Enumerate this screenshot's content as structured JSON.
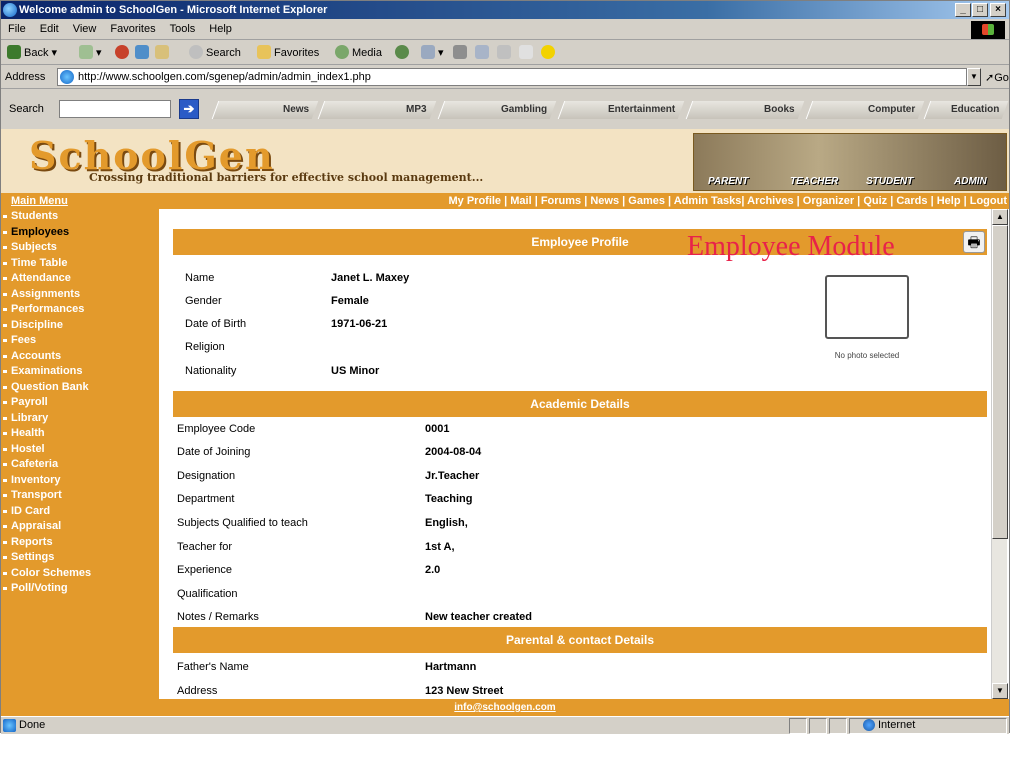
{
  "window": {
    "title": "Welcome admin to SchoolGen - Microsoft Internet Explorer",
    "buttons": [
      "_",
      "□",
      "×"
    ]
  },
  "menubar": [
    "File",
    "Edit",
    "View",
    "Favorites",
    "Tools",
    "Help"
  ],
  "toolbar": {
    "back": "Back",
    "search": "Search",
    "favorites": "Favorites",
    "media": "Media"
  },
  "address": {
    "label": "Address",
    "url": "http://www.schoolgen.com/sgenep/admin/admin_index1.php",
    "go": "Go"
  },
  "searchbar": {
    "label": "Search",
    "tabs": [
      "News",
      "MP3",
      "Gambling",
      "Entertainment",
      "Books",
      "Computer",
      "Education"
    ]
  },
  "site": {
    "logo": "SchoolGen",
    "tagline": "Crossing traditional barriers for effective school management...",
    "banner_labels": [
      "PARENT",
      "TEACHER",
      "STUDENT",
      "ADMIN"
    ],
    "main_menu": "Main Menu",
    "top_links": "My Profile | Mail | Forums | News | Games | Admin Tasks| Archives | Organizer | Quiz | Cards | Help | Logout",
    "footer_email": "info@schoolgen.com"
  },
  "sidebar": [
    "Students",
    "Employees",
    "Subjects",
    "Time Table",
    "Attendance",
    "Assignments",
    "Performances",
    "Discipline",
    "Fees",
    "Accounts",
    "Examinations",
    "Question Bank",
    "Payroll",
    "Library",
    "Health",
    "Hostel",
    "Cafeteria",
    "Inventory",
    "Transport",
    "ID Card",
    "Appraisal",
    "Reports",
    "Settings",
    "Color Schemes",
    "Poll/Voting"
  ],
  "profile": {
    "section_title": "Employee Profile",
    "module_title": "Employee Module",
    "photo_caption": "No photo selected",
    "fields": [
      {
        "label": "Name",
        "value": "Janet L. Maxey"
      },
      {
        "label": "Gender",
        "value": "Female"
      },
      {
        "label": "Date of Birth",
        "value": "1971-06-21"
      },
      {
        "label": "Religion",
        "value": ""
      },
      {
        "label": "Nationality",
        "value": "US Minor"
      }
    ]
  },
  "academic": {
    "section_title": "Academic Details",
    "fields": [
      {
        "label": "Employee Code",
        "value": "0001"
      },
      {
        "label": "Date of Joining",
        "value": "2004-08-04"
      },
      {
        "label": "Designation",
        "value": "Jr.Teacher"
      },
      {
        "label": "Department",
        "value": "Teaching"
      },
      {
        "label": "Subjects Qualified to teach",
        "value": "English,"
      },
      {
        "label": "Teacher for",
        "value": "1st A,"
      },
      {
        "label": "Experience",
        "value": "2.0"
      },
      {
        "label": "Qualification",
        "value": ""
      },
      {
        "label": "Notes / Remarks",
        "value": "New teacher created"
      }
    ]
  },
  "parental": {
    "section_title": "Parental & contact Details",
    "fields": [
      {
        "label": "Father's Name",
        "value": "Hartmann"
      },
      {
        "label": "Address",
        "value": "123 New Street"
      }
    ]
  },
  "status": {
    "text": "Done",
    "zone": "Internet"
  },
  "colors": {
    "accent": "#e39a2c",
    "page_bg": "#f3e3c3",
    "module_title": "#e8224a"
  }
}
